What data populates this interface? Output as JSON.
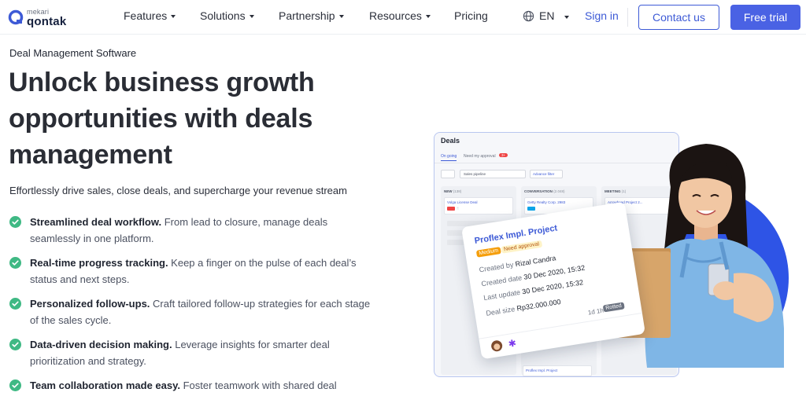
{
  "brand": {
    "small": "mekari",
    "name": "qontak"
  },
  "nav": {
    "items": [
      {
        "label": "Features",
        "dropdown": true
      },
      {
        "label": "Solutions",
        "dropdown": true
      },
      {
        "label": "Partnership",
        "dropdown": true
      },
      {
        "label": "Resources",
        "dropdown": true
      },
      {
        "label": "Pricing",
        "dropdown": false
      }
    ],
    "language": "EN",
    "sign_in": "Sign in",
    "contact_us": "Contact us",
    "free_trial": "Free trial"
  },
  "hero": {
    "eyebrow": "Deal Management Software",
    "headline": "Unlock business growth opportunities with deals management",
    "subline": "Effortlessly drive sales, close deals, and supercharge your revenue stream",
    "features": [
      {
        "title": "Streamlined deal workflow.",
        "text": " From lead to closure, manage deals seamlessly in one platform."
      },
      {
        "title": "Real-time progress tracking.",
        "text": " Keep a finger on the pulse of each deal’s status and next steps."
      },
      {
        "title": "Personalized follow-ups.",
        "text": " Craft tailored follow-up strategies for each stage of the sales cycle."
      },
      {
        "title": "Data-driven decision making.",
        "text": " Leverage insights for smarter deal prioritization and strategy."
      },
      {
        "title": "Team collaboration made easy.",
        "text": " Foster teamwork with shared deal"
      }
    ]
  },
  "app": {
    "title": "Deals",
    "tabs": [
      "On going",
      "Need my approval"
    ],
    "tab_badge": "3+",
    "pipeline_select": "Sales pipeline",
    "filter": "Advance filter",
    "columns": [
      {
        "name": "NEW",
        "count": "(138)",
        "card": "Volga License Deal"
      },
      {
        "name": "CONVERSATION",
        "count": "(2.048)",
        "card": "Getty Realty Corp. 2983"
      },
      {
        "name": "MEETING",
        "count": "(1)",
        "card": "Arrowhead Project 2..."
      }
    ],
    "bottom_card": "Proflex Impl. Project"
  },
  "deal_card": {
    "title": "Proflex Impl. Project",
    "priority": "Medium",
    "approval": "Need approval",
    "created_by_label": "Created by",
    "created_by": "Rizal Candra",
    "created_date_label": "Created date",
    "created_date": "30 Dec 2020, 15:32",
    "last_update_label": "Last update",
    "last_update": "30 Dec 2020, 15:32",
    "deal_size_label": "Deal size",
    "deal_size": "Rp32.000.000",
    "age": "1d 1h",
    "status": "Rotted"
  },
  "colors": {
    "primary": "#4a62e4",
    "link": "#3d5ad6",
    "check": "#3fb984",
    "blob": "#2e54e6"
  }
}
